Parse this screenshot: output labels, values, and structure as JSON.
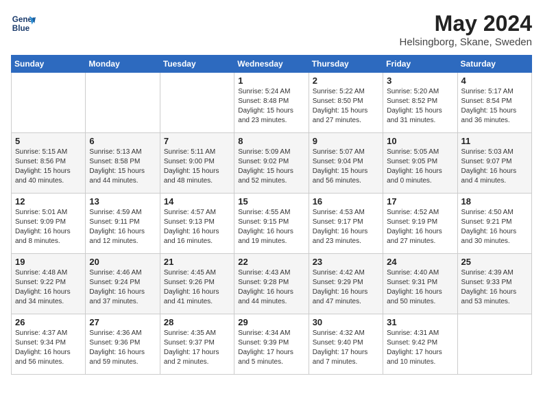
{
  "header": {
    "logo_line1": "General",
    "logo_line2": "Blue",
    "month_year": "May 2024",
    "location": "Helsingborg, Skane, Sweden"
  },
  "weekdays": [
    "Sunday",
    "Monday",
    "Tuesday",
    "Wednesday",
    "Thursday",
    "Friday",
    "Saturday"
  ],
  "weeks": [
    [
      {
        "day": "",
        "info": ""
      },
      {
        "day": "",
        "info": ""
      },
      {
        "day": "",
        "info": ""
      },
      {
        "day": "1",
        "info": "Sunrise: 5:24 AM\nSunset: 8:48 PM\nDaylight: 15 hours\nand 23 minutes."
      },
      {
        "day": "2",
        "info": "Sunrise: 5:22 AM\nSunset: 8:50 PM\nDaylight: 15 hours\nand 27 minutes."
      },
      {
        "day": "3",
        "info": "Sunrise: 5:20 AM\nSunset: 8:52 PM\nDaylight: 15 hours\nand 31 minutes."
      },
      {
        "day": "4",
        "info": "Sunrise: 5:17 AM\nSunset: 8:54 PM\nDaylight: 15 hours\nand 36 minutes."
      }
    ],
    [
      {
        "day": "5",
        "info": "Sunrise: 5:15 AM\nSunset: 8:56 PM\nDaylight: 15 hours\nand 40 minutes."
      },
      {
        "day": "6",
        "info": "Sunrise: 5:13 AM\nSunset: 8:58 PM\nDaylight: 15 hours\nand 44 minutes."
      },
      {
        "day": "7",
        "info": "Sunrise: 5:11 AM\nSunset: 9:00 PM\nDaylight: 15 hours\nand 48 minutes."
      },
      {
        "day": "8",
        "info": "Sunrise: 5:09 AM\nSunset: 9:02 PM\nDaylight: 15 hours\nand 52 minutes."
      },
      {
        "day": "9",
        "info": "Sunrise: 5:07 AM\nSunset: 9:04 PM\nDaylight: 15 hours\nand 56 minutes."
      },
      {
        "day": "10",
        "info": "Sunrise: 5:05 AM\nSunset: 9:05 PM\nDaylight: 16 hours\nand 0 minutes."
      },
      {
        "day": "11",
        "info": "Sunrise: 5:03 AM\nSunset: 9:07 PM\nDaylight: 16 hours\nand 4 minutes."
      }
    ],
    [
      {
        "day": "12",
        "info": "Sunrise: 5:01 AM\nSunset: 9:09 PM\nDaylight: 16 hours\nand 8 minutes."
      },
      {
        "day": "13",
        "info": "Sunrise: 4:59 AM\nSunset: 9:11 PM\nDaylight: 16 hours\nand 12 minutes."
      },
      {
        "day": "14",
        "info": "Sunrise: 4:57 AM\nSunset: 9:13 PM\nDaylight: 16 hours\nand 16 minutes."
      },
      {
        "day": "15",
        "info": "Sunrise: 4:55 AM\nSunset: 9:15 PM\nDaylight: 16 hours\nand 19 minutes."
      },
      {
        "day": "16",
        "info": "Sunrise: 4:53 AM\nSunset: 9:17 PM\nDaylight: 16 hours\nand 23 minutes."
      },
      {
        "day": "17",
        "info": "Sunrise: 4:52 AM\nSunset: 9:19 PM\nDaylight: 16 hours\nand 27 minutes."
      },
      {
        "day": "18",
        "info": "Sunrise: 4:50 AM\nSunset: 9:21 PM\nDaylight: 16 hours\nand 30 minutes."
      }
    ],
    [
      {
        "day": "19",
        "info": "Sunrise: 4:48 AM\nSunset: 9:22 PM\nDaylight: 16 hours\nand 34 minutes."
      },
      {
        "day": "20",
        "info": "Sunrise: 4:46 AM\nSunset: 9:24 PM\nDaylight: 16 hours\nand 37 minutes."
      },
      {
        "day": "21",
        "info": "Sunrise: 4:45 AM\nSunset: 9:26 PM\nDaylight: 16 hours\nand 41 minutes."
      },
      {
        "day": "22",
        "info": "Sunrise: 4:43 AM\nSunset: 9:28 PM\nDaylight: 16 hours\nand 44 minutes."
      },
      {
        "day": "23",
        "info": "Sunrise: 4:42 AM\nSunset: 9:29 PM\nDaylight: 16 hours\nand 47 minutes."
      },
      {
        "day": "24",
        "info": "Sunrise: 4:40 AM\nSunset: 9:31 PM\nDaylight: 16 hours\nand 50 minutes."
      },
      {
        "day": "25",
        "info": "Sunrise: 4:39 AM\nSunset: 9:33 PM\nDaylight: 16 hours\nand 53 minutes."
      }
    ],
    [
      {
        "day": "26",
        "info": "Sunrise: 4:37 AM\nSunset: 9:34 PM\nDaylight: 16 hours\nand 56 minutes."
      },
      {
        "day": "27",
        "info": "Sunrise: 4:36 AM\nSunset: 9:36 PM\nDaylight: 16 hours\nand 59 minutes."
      },
      {
        "day": "28",
        "info": "Sunrise: 4:35 AM\nSunset: 9:37 PM\nDaylight: 17 hours\nand 2 minutes."
      },
      {
        "day": "29",
        "info": "Sunrise: 4:34 AM\nSunset: 9:39 PM\nDaylight: 17 hours\nand 5 minutes."
      },
      {
        "day": "30",
        "info": "Sunrise: 4:32 AM\nSunset: 9:40 PM\nDaylight: 17 hours\nand 7 minutes."
      },
      {
        "day": "31",
        "info": "Sunrise: 4:31 AM\nSunset: 9:42 PM\nDaylight: 17 hours\nand 10 minutes."
      },
      {
        "day": "",
        "info": ""
      }
    ]
  ]
}
